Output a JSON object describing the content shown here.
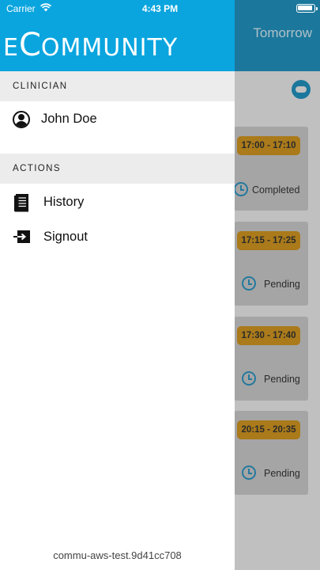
{
  "status_bar": {
    "carrier": "Carrier",
    "time": "4:43 PM"
  },
  "background": {
    "header_title": "Tomorrow",
    "appointments": [
      {
        "time": "17:00 - 17:10",
        "status": "Completed"
      },
      {
        "time": "17:15 - 17:25",
        "status": "Pending"
      },
      {
        "time": "17:30 - 17:40",
        "status": "Pending"
      },
      {
        "time": "20:15 - 20:35",
        "status": "Pending"
      }
    ]
  },
  "drawer": {
    "logo_first": "E",
    "logo_big_c": "C",
    "logo_rest": "OMMUNITY",
    "clinician_section": "CLINICIAN",
    "clinician_name": "John Doe",
    "actions_section": "ACTIONS",
    "actions": [
      {
        "label": "History",
        "icon": "history-icon"
      },
      {
        "label": "Signout",
        "icon": "signout-icon"
      }
    ],
    "version": "commu-aws-test.9d41cc708"
  },
  "colors": {
    "drawer_header": "#0aa5df",
    "app_header": "#0a85b6",
    "time_badge": "#c9890a",
    "section_bg": "#ececec"
  }
}
